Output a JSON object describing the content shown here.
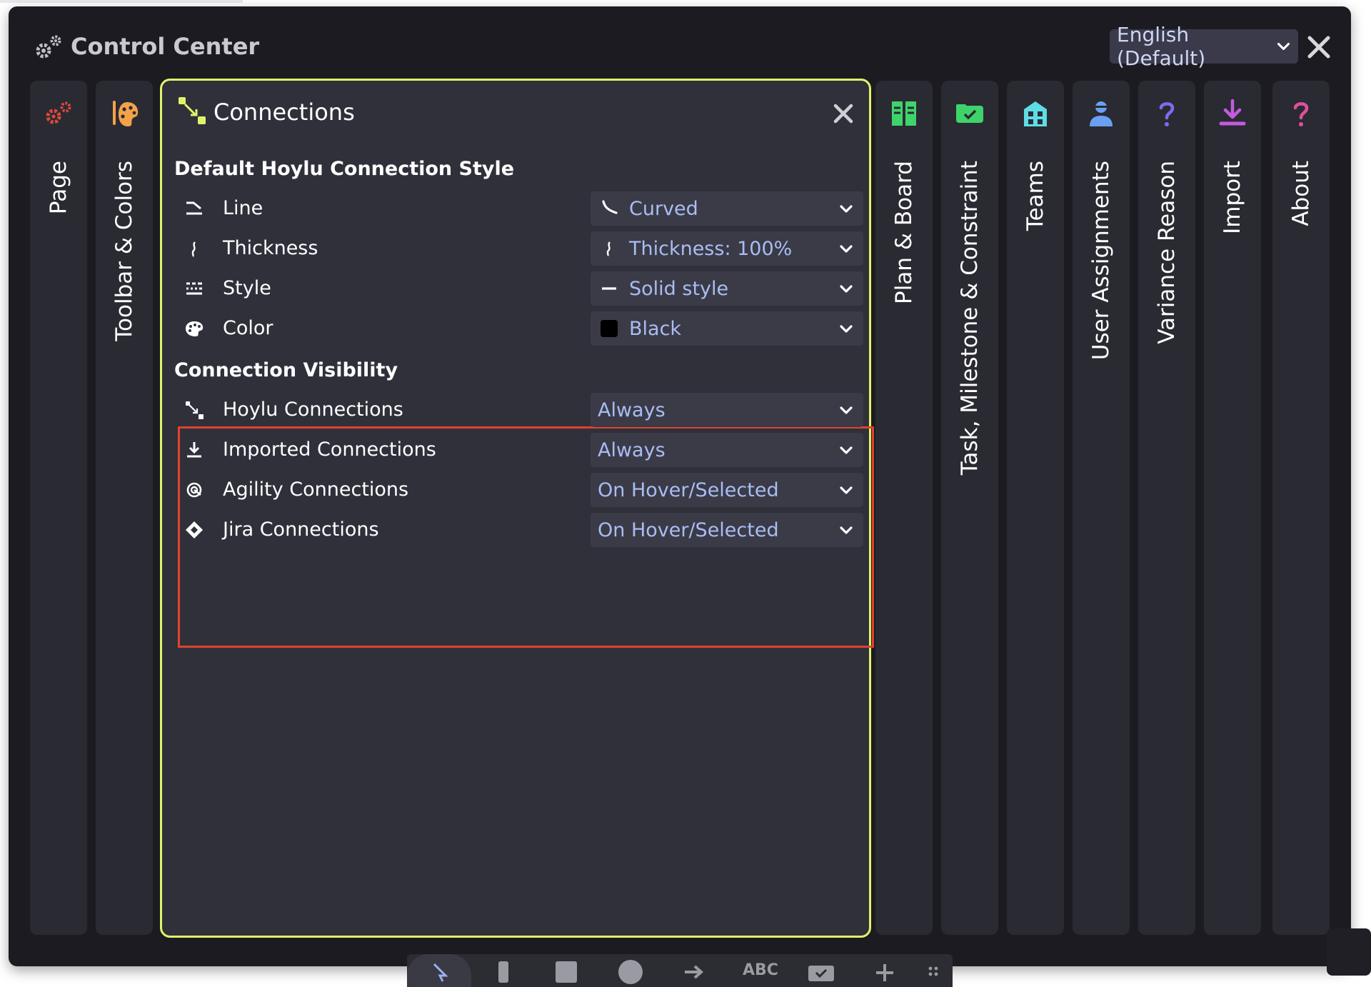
{
  "window": {
    "title": "Control Center",
    "language_select": {
      "value": "English (Default)"
    }
  },
  "left_tabs": [
    {
      "label": "Page",
      "icon": "gears-icon",
      "color": "#e0483a"
    },
    {
      "label": "Toolbar & Colors",
      "icon": "palette-icon",
      "color": "#f2a34a"
    }
  ],
  "panel": {
    "title": "Connections",
    "default_style": {
      "heading": "Default Hoylu Connection Style",
      "rows": [
        {
          "label": "Line",
          "value": "Curved",
          "icon": "line-shape-icon",
          "value_icon": "curved-line-icon"
        },
        {
          "label": "Thickness",
          "value": "Thickness: 100%",
          "icon": "thickness-icon",
          "value_icon": "thickness-icon"
        },
        {
          "label": "Style",
          "value": "Solid style",
          "icon": "dashed-style-icon",
          "value_icon": "solid-line-icon"
        },
        {
          "label": "Color",
          "value": "Black",
          "icon": "palette-icon",
          "value_color": "#000000"
        }
      ]
    },
    "visibility": {
      "heading": "Connection Visibility",
      "rows": [
        {
          "label": "Hoylu Connections",
          "value": "Always",
          "icon": "connection-icon"
        },
        {
          "label": "Imported Connections",
          "value": "Always",
          "icon": "import-icon"
        },
        {
          "label": "Agility Connections",
          "value": "On Hover/Selected",
          "icon": "agility-icon"
        },
        {
          "label": "Jira Connections",
          "value": "On Hover/Selected",
          "icon": "jira-icon"
        }
      ]
    }
  },
  "right_tabs": [
    {
      "label": "Plan & Board",
      "icon": "plan-board-icon",
      "color": "#3fd46b"
    },
    {
      "label": "Task, Milestone & Constraint",
      "icon": "task-card-icon",
      "color": "#3fd46b"
    },
    {
      "label": "Teams",
      "icon": "building-icon",
      "color": "#5fdde6"
    },
    {
      "label": "User Assignments",
      "icon": "user-icon",
      "color": "#6aa0f2"
    },
    {
      "label": "Variance Reason",
      "icon": "question-icon",
      "color": "#7b6cf0"
    },
    {
      "label": "Import",
      "icon": "download-icon",
      "color": "#c55ae0"
    },
    {
      "label": "About",
      "icon": "question-icon",
      "color": "#e0509a"
    }
  ],
  "bottom_toolbar": {
    "text_tool_label": "ABC"
  }
}
